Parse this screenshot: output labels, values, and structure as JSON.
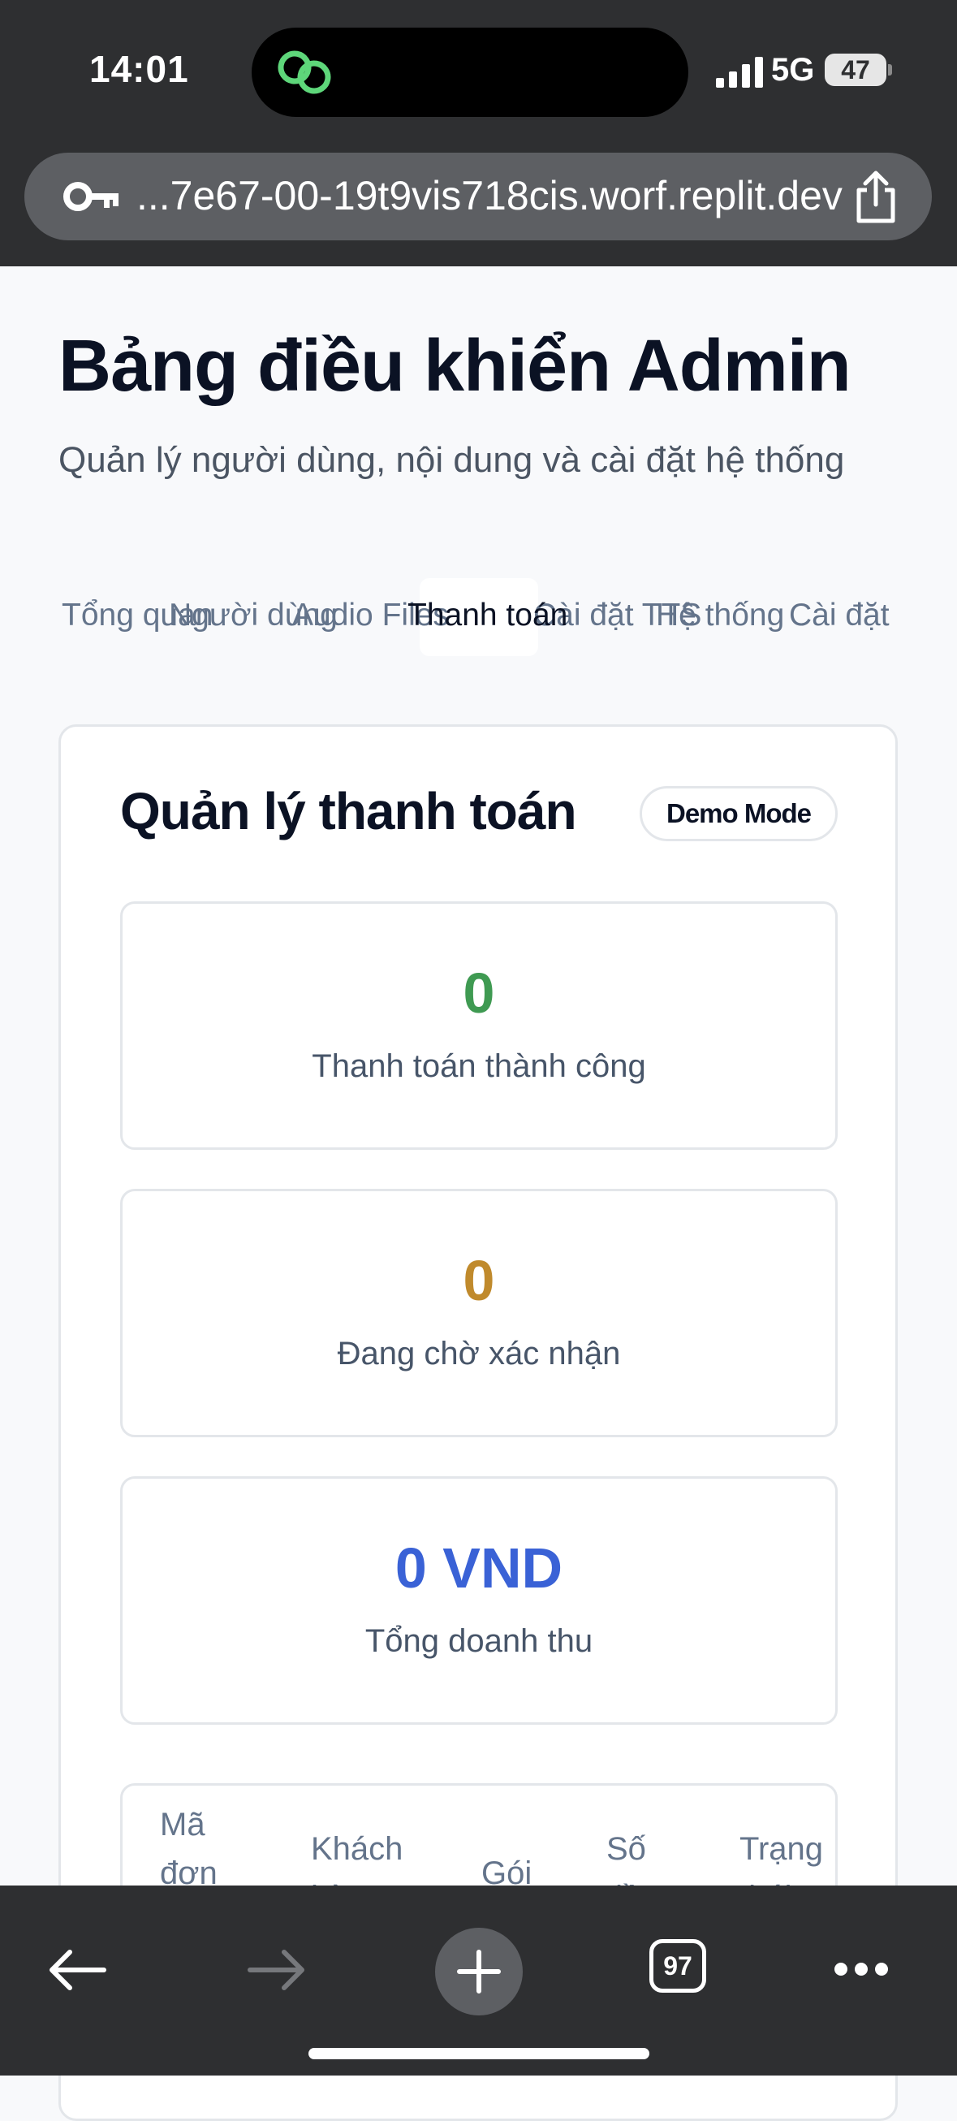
{
  "status_bar": {
    "time": "14:01",
    "network": "5G",
    "battery": "47"
  },
  "browser": {
    "url": "...7e67-00-19t9vis718cis.worf.replit.dev",
    "tab_count": "97"
  },
  "page": {
    "title": "Bảng điều khiển Admin",
    "subtitle": "Quản lý người dùng, nội dung và cài đặt hệ thống"
  },
  "tabs": [
    {
      "label": "Tổng quan"
    },
    {
      "label": "Người dùng"
    },
    {
      "label": "Audio Files"
    },
    {
      "label": "Thanh toán",
      "active": true
    },
    {
      "label": "Cài đặt TTS"
    },
    {
      "label": "Hệ thống"
    },
    {
      "label": "Cài đặt"
    }
  ],
  "payments": {
    "title": "Quản lý thanh toán",
    "badge": "Demo Mode",
    "stats": [
      {
        "value": "0",
        "label": "Thanh toán thành công",
        "color": "#3f9a52"
      },
      {
        "value": "0",
        "label": "Đang chờ xác nhận",
        "color": "#c08a2c"
      },
      {
        "value": "0 VND",
        "label": "Tổng doanh thu",
        "color": "#3a62d6"
      }
    ],
    "table_headers": [
      "Mã đơn",
      "Khách hàng",
      "Gói",
      "Số tiền",
      "Trạng thái"
    ]
  }
}
